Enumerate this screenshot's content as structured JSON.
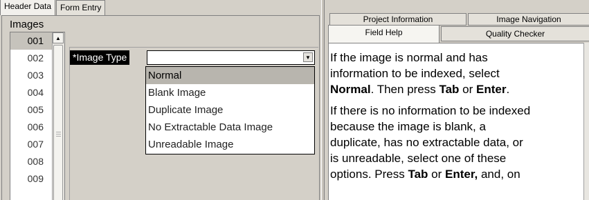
{
  "left_panel": {
    "tabs": [
      {
        "label": "Header Data",
        "active": true
      },
      {
        "label": "Form Entry",
        "active": false
      }
    ],
    "images_label": "Images",
    "image_list": [
      "001",
      "002",
      "003",
      "004",
      "005",
      "006",
      "007",
      "008",
      "009"
    ],
    "selected_image": "001",
    "field": {
      "label": "*Image Type",
      "value": "",
      "options": [
        "Normal",
        "Blank Image",
        "Duplicate Image",
        "No Extractable Data Image",
        "Unreadable Image"
      ],
      "highlighted_option": "Normal"
    }
  },
  "right_panel": {
    "tabs_top": [
      "Project Information",
      "Image Navigation"
    ],
    "tabs_bottom": [
      "Field Help",
      "Quality Checker"
    ],
    "active_tab": "Field Help",
    "help": {
      "p1_line1": "If the image is normal and has",
      "p1_line2": "information to be indexed, select",
      "p1_bold1": "Normal",
      "p1_mid": ". Then press ",
      "p1_bold2": "Tab",
      "p1_or": " or ",
      "p1_bold3": "Enter",
      "p1_end": ".",
      "p2_line1": "If there is no information to be indexed",
      "p2_line2": "because the image is blank, a",
      "p2_line3": "duplicate, has no extractable data, or",
      "p2_line4": "is unreadable, select one of these",
      "p2_start": "options. Press ",
      "p2_bold1": "Tab",
      "p2_or": " or ",
      "p2_bold2": "Enter,",
      "p2_end": " and, on"
    }
  },
  "colors": {
    "panel_bg": "#d4d0c8",
    "label_bg": "#000000",
    "selection_bg": "#b8b5ae"
  }
}
